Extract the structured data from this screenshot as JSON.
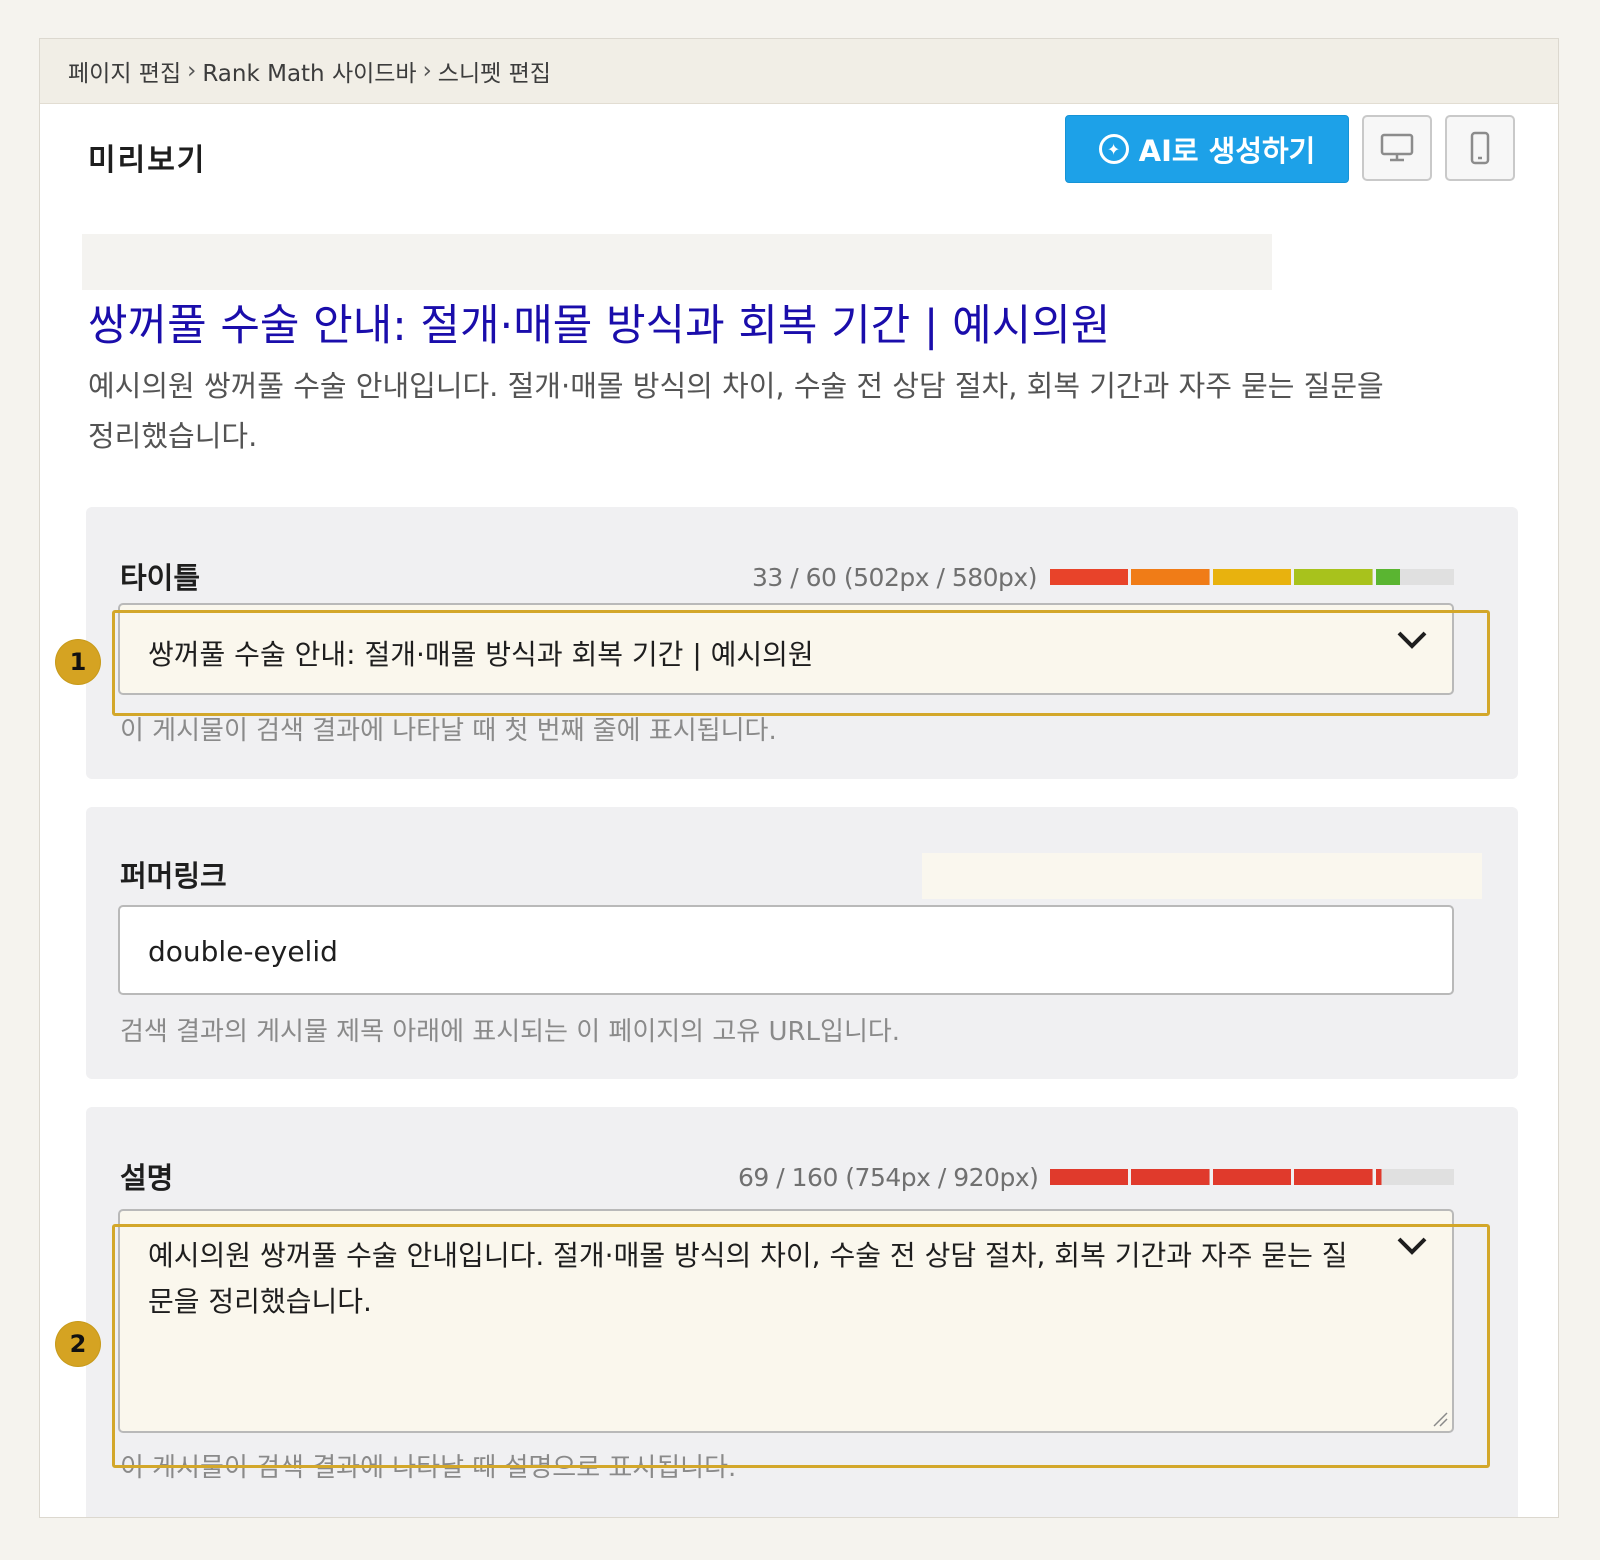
{
  "breadcrumb": {
    "items": [
      "페이지 편집",
      "Rank Math 사이드바",
      "스니펫 편집"
    ],
    "separator": "›"
  },
  "header": {
    "title": "미리보기",
    "ai_button_label": "AI로 생성하기",
    "device_buttons": [
      "desktop-icon",
      "mobile-icon"
    ]
  },
  "serp_preview": {
    "title": "쌍꺼풀 수술 안내: 절개·매몰 방식과 회복 기간 | 예시의원",
    "description": "예시의원 쌍꺼풀 수술 안내입니다. 절개·매몰 방식의 차이, 수술 전 상담 절차, 회복 기간과 자주 묻는 질문을 정리했습니다."
  },
  "title_field": {
    "label": "타이틀",
    "counter": "33 / 60 (502px / 580px)",
    "fill_ratio": 0.865,
    "value": "쌍꺼풀 수술 안내: 절개·매몰 방식과 회복 기간 | 예시의원",
    "help": "이 게시물이 검색 결과에 나타날 때 첫 번째 줄에 표시됩니다.",
    "meter_colors": [
      "#e8432a",
      "#f07c17",
      "#e8b20e",
      "#a8c21c",
      "#5ab531"
    ]
  },
  "permalink_field": {
    "label": "퍼머링크",
    "value": "double-eyelid",
    "help": "검색 결과의 게시물 제목 아래에 표시되는 이 페이지의 고유 URL입니다."
  },
  "description_field": {
    "label": "설명",
    "counter": "69 / 160 (754px / 920px)",
    "fill_ratio": 0.82,
    "value": "예시의원 쌍꺼풀 수술 안내입니다. 절개·매몰 방식의 차이, 수술 전 상담 절차, 회복 기간과 자주 묻는 질문을 정리했습니다.",
    "help": "이 게시물이 검색 결과에 나타날 때 설명으로 표시됩니다.",
    "meter_color": "#e03a2c"
  },
  "callouts": [
    "1",
    "2"
  ],
  "colors": {
    "accent": "#1da1e8",
    "highlight": "#d3a72a",
    "serp_link": "#1a0dab"
  }
}
